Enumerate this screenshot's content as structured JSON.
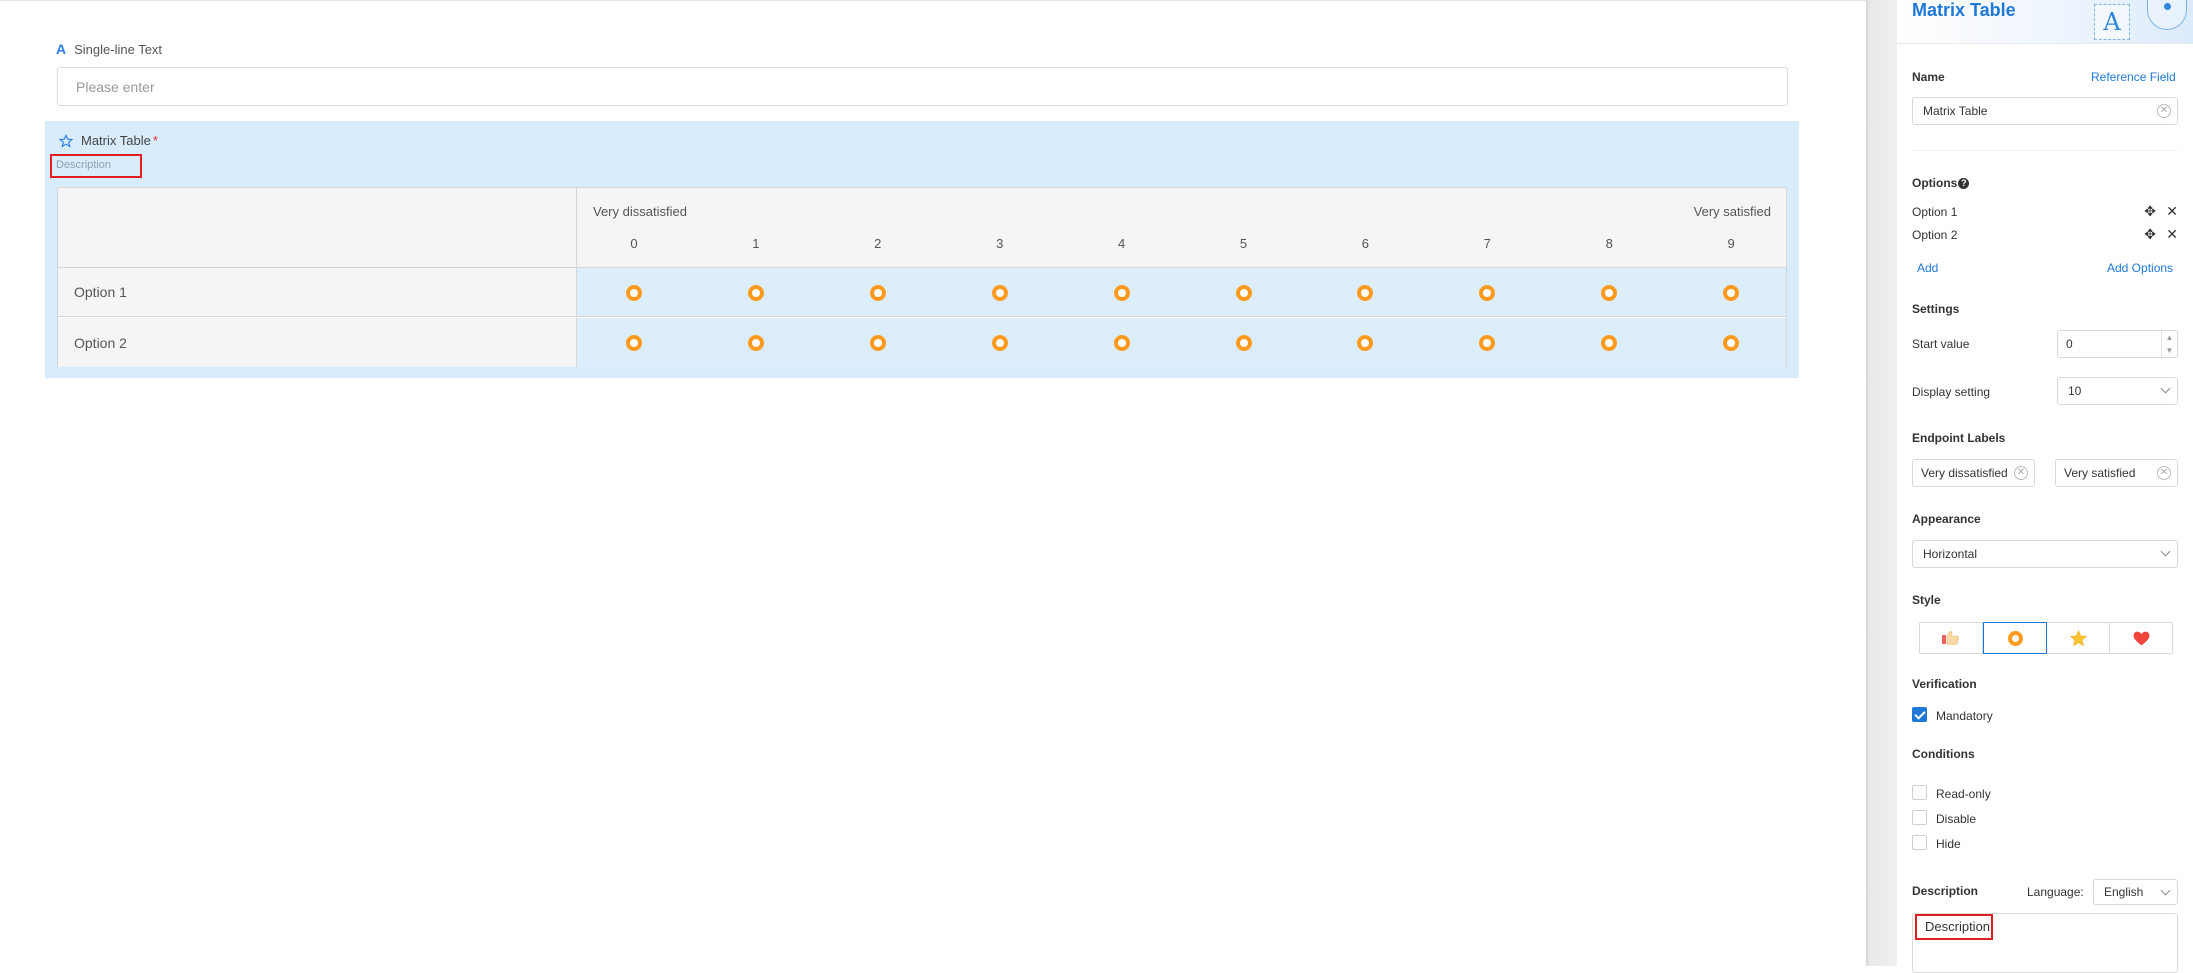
{
  "form": {
    "single_line_label": "Single-line Text",
    "single_line_placeholder": "Please enter",
    "matrix_title": "Matrix Table",
    "matrix_required_mark": "*",
    "matrix_description": "Description",
    "left_endpoint": "Very dissatisfied",
    "right_endpoint": "Very satisfied",
    "columns": [
      "0",
      "1",
      "2",
      "3",
      "4",
      "5",
      "6",
      "7",
      "8",
      "9"
    ],
    "rows": [
      "Option 1",
      "Option 2"
    ]
  },
  "panel": {
    "title": "Matrix Table",
    "header_icon_letter": "A",
    "name_label": "Name",
    "reference_field_link": "Reference Field",
    "name_value": "Matrix Table",
    "options_label": "Options",
    "help_icon": "?",
    "options": [
      "Option 1",
      "Option 2"
    ],
    "add_link": "Add",
    "add_options_link": "Add Options",
    "settings_label": "Settings",
    "start_value_label": "Start value",
    "start_value": "0",
    "display_setting_label": "Display setting",
    "display_setting_value": "10",
    "endpoint_labels_label": "Endpoint Labels",
    "endpoint_left": "Very dissatisfied",
    "endpoint_right": "Very satisfied",
    "appearance_label": "Appearance",
    "appearance_value": "Horizontal",
    "style_label": "Style",
    "style_options": [
      "thumbs-icon",
      "ring-icon",
      "star-icon",
      "heart-icon"
    ],
    "style_selected": "ring-icon",
    "verification_label": "Verification",
    "mandatory_label": "Mandatory",
    "mandatory_checked": true,
    "conditions_label": "Conditions",
    "conditions": [
      "Read-only",
      "Disable",
      "Hide"
    ],
    "description_label": "Description",
    "language_label": "Language:",
    "language_value": "English",
    "description_value": "Description"
  },
  "colors": {
    "accent": "#1f78d8",
    "radio": "#ff9a1f",
    "selection_bg": "#d9ecfb",
    "highlight_box": "#e02020"
  }
}
